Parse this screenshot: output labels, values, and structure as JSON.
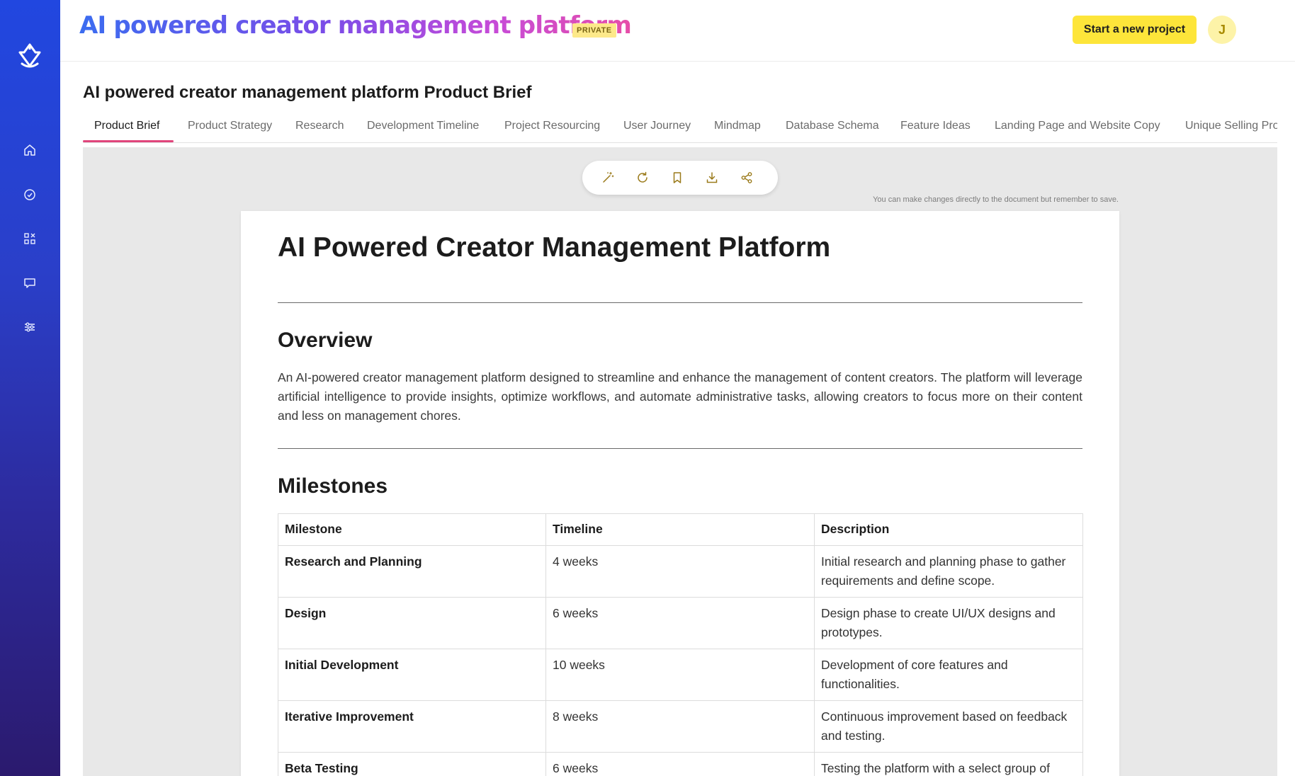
{
  "header": {
    "app_title": "AI powered creator management platform",
    "badge": "PRIVATE",
    "new_project_label": "Start a new project",
    "avatar_initial": "J"
  },
  "sidebar": {
    "items": [
      {
        "icon": "home-icon"
      },
      {
        "icon": "check-circle-icon"
      },
      {
        "icon": "apps-icon"
      },
      {
        "icon": "chat-icon"
      },
      {
        "icon": "sliders-icon"
      }
    ]
  },
  "page": {
    "title": "AI powered creator management platform Product Brief"
  },
  "tabs": [
    {
      "label": "Product Brief",
      "active": true
    },
    {
      "label": "Product Strategy"
    },
    {
      "label": "Research"
    },
    {
      "label": "Development Timeline"
    },
    {
      "label": "Project Resourcing"
    },
    {
      "label": "User Journey"
    },
    {
      "label": "Mindmap"
    },
    {
      "label": "Database Schema"
    },
    {
      "label": "Feature Ideas"
    },
    {
      "label": "Landing Page and Website Copy"
    },
    {
      "label": "Unique Selling Prop"
    }
  ],
  "toolbar": {
    "tools": [
      "magic-wand-icon",
      "refresh-icon",
      "bookmark-icon",
      "download-icon",
      "share-icon"
    ],
    "hint": "You can make changes directly to the document but remember to save."
  },
  "document": {
    "title": "AI Powered Creator Management Platform",
    "overview_heading": "Overview",
    "overview_text": "An AI-powered creator management platform designed to streamline and enhance the management of content creators. The platform will leverage artificial intelligence to provide insights, optimize workflows, and automate administrative tasks, allowing creators to focus more on their content and less on management chores.",
    "milestones_heading": "Milestones",
    "table": {
      "headers": [
        "Milestone",
        "Timeline",
        "Description"
      ],
      "rows": [
        [
          "Research and Planning",
          "4 weeks",
          "Initial research and planning phase to gather requirements and define scope."
        ],
        [
          "Design",
          "6 weeks",
          "Design phase to create UI/UX designs and prototypes."
        ],
        [
          "Initial Development",
          "10 weeks",
          "Development of core features and functionalities."
        ],
        [
          "Iterative Improvement",
          "8 weeks",
          "Continuous improvement based on feedback and testing."
        ],
        [
          "Beta Testing",
          "6 weeks",
          "Testing the platform with a select group of"
        ]
      ]
    }
  },
  "colors": {
    "accent_yellow": "#fde53a",
    "tab_underline": "#e0457b",
    "sidebar_top": "#2147e0",
    "sidebar_bottom": "#2b1a6e"
  }
}
